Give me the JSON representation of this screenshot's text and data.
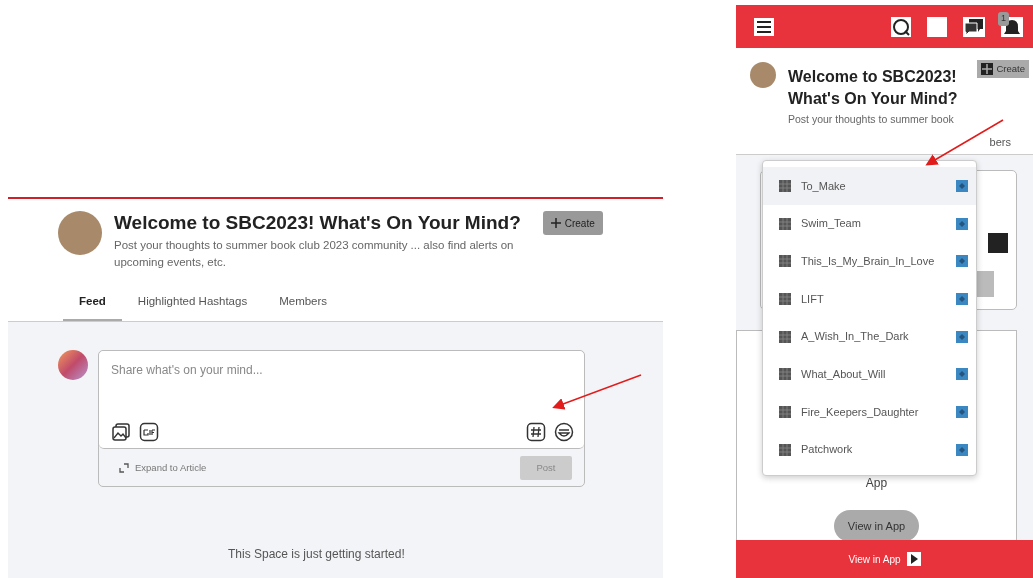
{
  "desktop": {
    "title": "Welcome to SBC2023! What's On Your Mind?",
    "description": "Post your thoughts to summer book club 2023 community ... also find alerts on upcoming events, etc.",
    "create_button": "Create",
    "tabs": [
      {
        "label": "Feed",
        "selected": true
      },
      {
        "label": "Highlighted Hashtags",
        "selected": false
      },
      {
        "label": "Members",
        "selected": false
      }
    ],
    "composer": {
      "placeholder": "Share what's on your mind...",
      "expand_link": "Expand to Article",
      "post_button": "Post",
      "post_disabled": true
    },
    "empty_message": "This Space is just getting started!"
  },
  "mobile": {
    "notification_count": "1",
    "title": "Welcome to SBC2023! What's On Your Mind?",
    "description": "Post your thoughts to summer book",
    "create_button": "Create",
    "tab_fragment": "bers",
    "hashtag_menu": [
      {
        "label": "To_Make",
        "selected": true
      },
      {
        "label": "Swim_Team",
        "selected": false
      },
      {
        "label": "This_Is_My_Brain_In_Love",
        "selected": false
      },
      {
        "label": "LIFT",
        "selected": false
      },
      {
        "label": "A_Wish_In_The_Dark",
        "selected": false
      },
      {
        "label": "What_About_Will",
        "selected": false
      },
      {
        "label": "Fire_Keepers_Daughter",
        "selected": false
      },
      {
        "label": "Patchwork",
        "selected": false
      }
    ],
    "card_text": "App",
    "card_button": "View in App",
    "bottom_bar": "View in App"
  }
}
